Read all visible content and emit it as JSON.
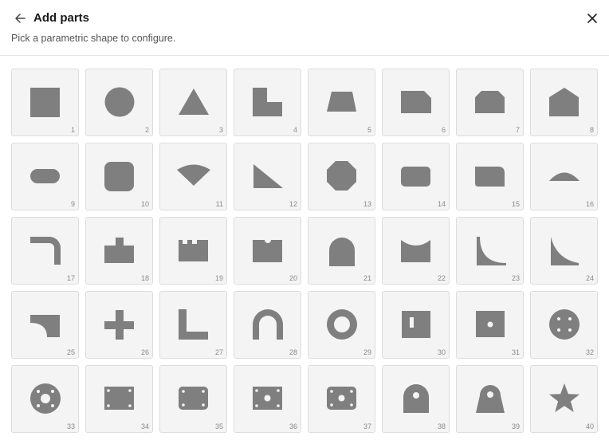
{
  "dialog": {
    "title": "Add parts",
    "subtitle": "Pick a parametric shape to configure."
  },
  "colors": {
    "shape": "#7f7f7f",
    "tile_bg": "#f4f4f4",
    "tile_border": "#dcdcdc"
  },
  "parts": [
    {
      "number": "1",
      "icon": "square-icon"
    },
    {
      "number": "2",
      "icon": "circle-icon"
    },
    {
      "number": "3",
      "icon": "triangle-icon"
    },
    {
      "number": "4",
      "icon": "l-notch-icon"
    },
    {
      "number": "5",
      "icon": "trapezoid-icon"
    },
    {
      "number": "6",
      "icon": "chamfer-corner-icon"
    },
    {
      "number": "7",
      "icon": "chamfered-rectangle-icon"
    },
    {
      "number": "8",
      "icon": "pentagon-house-icon"
    },
    {
      "number": "9",
      "icon": "slot-icon"
    },
    {
      "number": "10",
      "icon": "rounded-square-icon"
    },
    {
      "number": "11",
      "icon": "sector-icon"
    },
    {
      "number": "12",
      "icon": "right-triangle-icon"
    },
    {
      "number": "13",
      "icon": "octagon-icon"
    },
    {
      "number": "14",
      "icon": "rounded-rectangle-icon"
    },
    {
      "number": "15",
      "icon": "one-rounded-corner-rectangle-icon"
    },
    {
      "number": "16",
      "icon": "circular-segment-icon"
    },
    {
      "number": "17",
      "icon": "bent-bar-icon"
    },
    {
      "number": "18",
      "icon": "stepped-block-icon"
    },
    {
      "number": "19",
      "icon": "castellated-block-icon"
    },
    {
      "number": "20",
      "icon": "notched-rectangle-icon"
    },
    {
      "number": "21",
      "icon": "arch-icon"
    },
    {
      "number": "22",
      "icon": "concave-rectangle-icon"
    },
    {
      "number": "23",
      "icon": "concave-fillet-icon"
    },
    {
      "number": "24",
      "icon": "concave-spandrel-icon"
    },
    {
      "number": "25",
      "icon": "cove-corner-rectangle-icon"
    },
    {
      "number": "26",
      "icon": "plus-cross-icon"
    },
    {
      "number": "27",
      "icon": "l-bracket-icon"
    },
    {
      "number": "28",
      "icon": "u-hook-icon"
    },
    {
      "number": "29",
      "icon": "ring-icon"
    },
    {
      "number": "30",
      "icon": "plate-with-slot-icon"
    },
    {
      "number": "31",
      "icon": "plate-with-hole-icon"
    },
    {
      "number": "32",
      "icon": "disc-four-holes-icon"
    },
    {
      "number": "33",
      "icon": "flange-icon"
    },
    {
      "number": "34",
      "icon": "plate-four-holes-icon"
    },
    {
      "number": "35",
      "icon": "rounded-plate-four-holes-icon"
    },
    {
      "number": "36",
      "icon": "plate-center-hole-four-holes-icon"
    },
    {
      "number": "37",
      "icon": "rounded-plate-center-hole-four-holes-icon"
    },
    {
      "number": "38",
      "icon": "lug-icon"
    },
    {
      "number": "39",
      "icon": "tapered-lug-icon"
    },
    {
      "number": "40",
      "icon": "star-icon"
    }
  ]
}
